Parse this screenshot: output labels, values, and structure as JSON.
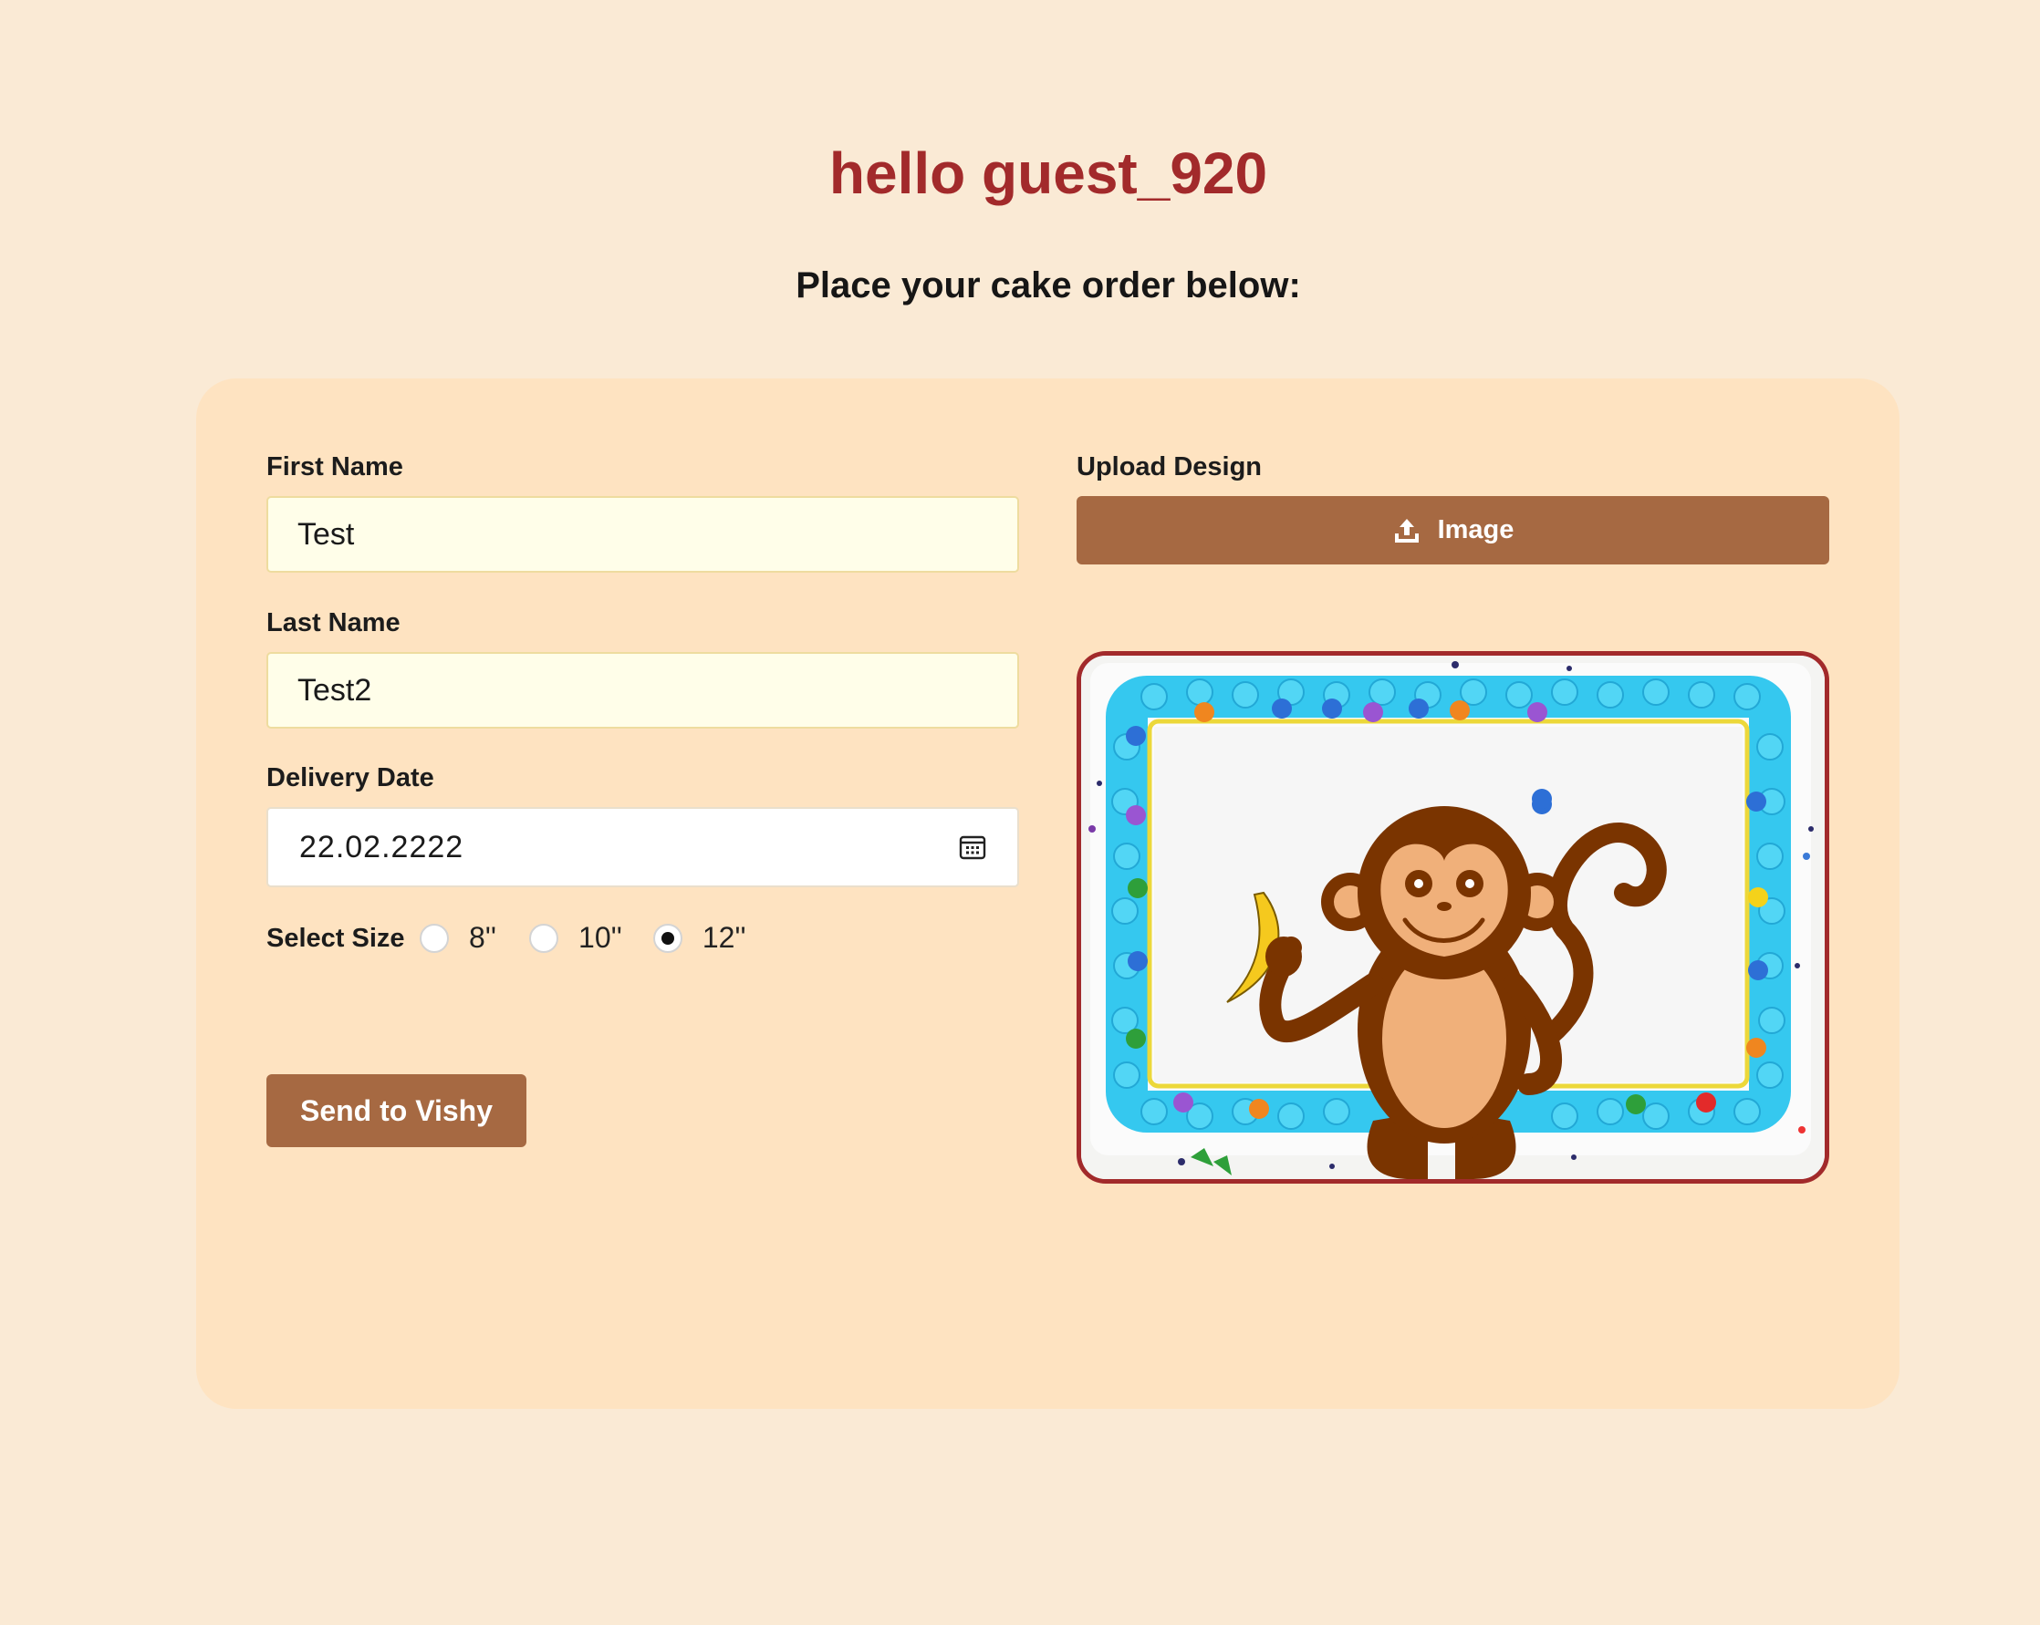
{
  "header": {
    "greeting": "hello guest_920",
    "subtitle": "Place your cake order below:"
  },
  "form": {
    "first_name_label": "First Name",
    "first_name_value": "Test",
    "last_name_label": "Last Name",
    "last_name_value": "Test2",
    "delivery_date_label": "Delivery Date",
    "delivery_date_value": "22.02.2222",
    "size_label": "Select Size",
    "sizes": [
      {
        "label": "8''",
        "checked": false
      },
      {
        "label": "10''",
        "checked": false
      },
      {
        "label": "12''",
        "checked": true
      }
    ],
    "submit_label": "Send to Vishy"
  },
  "upload": {
    "label": "Upload Design",
    "button_label": "Image",
    "preview_alt": "Cake with monkey holding banana"
  },
  "colors": {
    "page_bg": "#faead5",
    "card_bg": "#fee3c1",
    "accent": "#a66942",
    "greeting": "#a22a2b",
    "input_bg": "#fffee9"
  },
  "icons": {
    "calendar": "calendar-icon",
    "upload": "upload-icon"
  }
}
